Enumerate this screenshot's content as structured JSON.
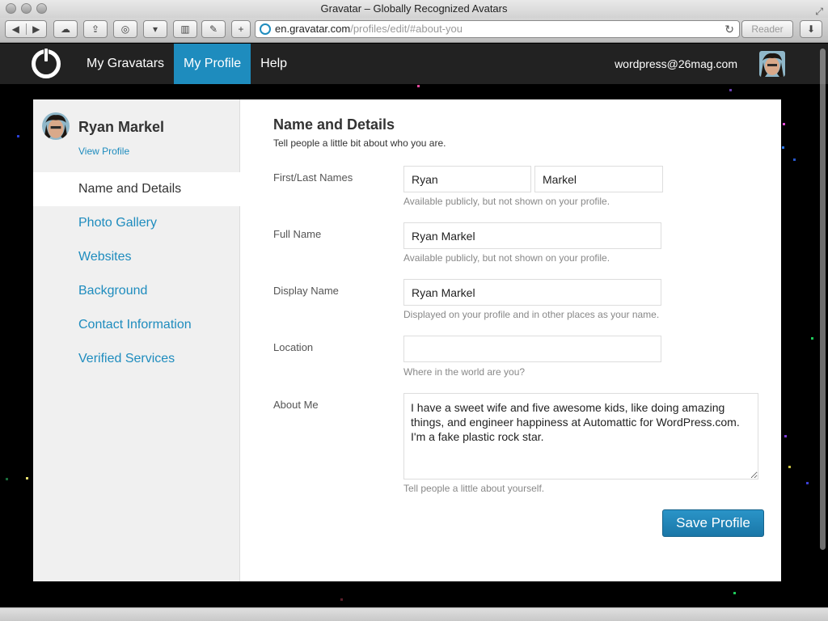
{
  "browser": {
    "window_title": "Gravatar – Globally Recognized Avatars",
    "url_host": "en.gravatar.com",
    "url_path": "/profiles/edit/#about-you",
    "reader_label": "Reader"
  },
  "header": {
    "nav": [
      "My Gravatars",
      "My Profile",
      "Help"
    ],
    "active_nav": "My Profile",
    "user_email": "wordpress@26mag.com"
  },
  "sidebar": {
    "name": "Ryan Markel",
    "view_profile": "View Profile",
    "items": [
      {
        "label": "Name and Details",
        "active": true
      },
      {
        "label": "Photo Gallery"
      },
      {
        "label": "Websites"
      },
      {
        "label": "Background"
      },
      {
        "label": "Contact Information"
      },
      {
        "label": "Verified Services"
      }
    ]
  },
  "form": {
    "title": "Name and Details",
    "subtitle": "Tell people a little bit about who you are.",
    "first_last_label": "First/Last Names",
    "first_name": "Ryan",
    "last_name": "Markel",
    "first_last_hint": "Available publicly, but not shown on your profile.",
    "full_name_label": "Full Name",
    "full_name": "Ryan Markel",
    "full_name_hint": "Available publicly, but not shown on your profile.",
    "display_name_label": "Display Name",
    "display_name": "Ryan Markel",
    "display_name_hint": "Displayed on your profile and in other places as your name.",
    "location_label": "Location",
    "location": "",
    "location_hint": "Where in the world are you?",
    "about_label": "About Me",
    "about": "I have a sweet wife and five awesome kids, like doing amazing things, and engineer happiness at Automattic for WordPress.com. I'm a fake plastic rock star.",
    "about_hint": "Tell people a little about yourself.",
    "save_label": "Save Profile"
  },
  "colors": {
    "accent": "#1e8cbe",
    "header_bg": "#222222",
    "page_bg": "#000000"
  }
}
